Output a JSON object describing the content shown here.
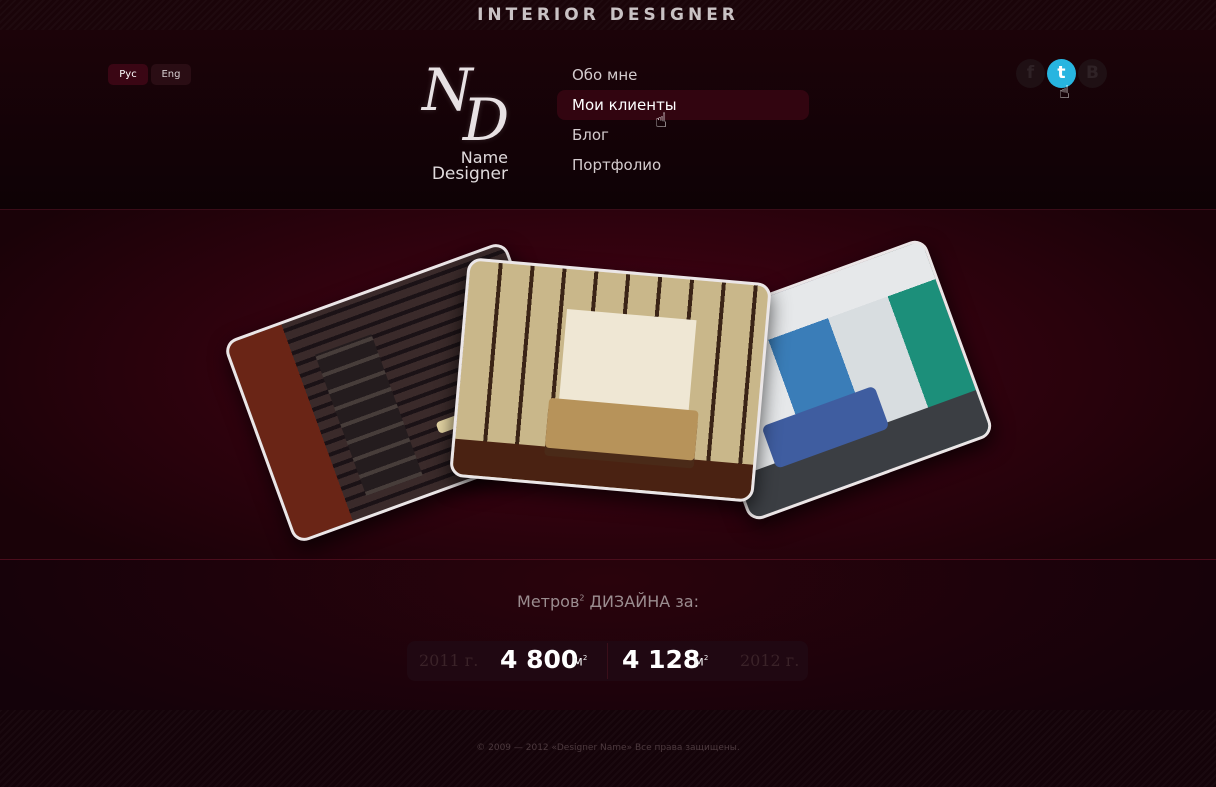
{
  "site_title": "INTERIOR DESIGNER",
  "languages": [
    {
      "label": "Рус",
      "active": true
    },
    {
      "label": "Eng",
      "active": false
    }
  ],
  "logo": {
    "monogram_n": "N",
    "monogram_d": "D",
    "line1": "Name",
    "line2": "Designer"
  },
  "nav": {
    "items": [
      {
        "label": "Обо мне",
        "active": false
      },
      {
        "label": "Мои клиенты",
        "active": true
      },
      {
        "label": "Блог",
        "active": false
      },
      {
        "label": "Портфолио",
        "active": false
      }
    ]
  },
  "social": [
    {
      "name": "facebook-icon",
      "glyph": "f"
    },
    {
      "name": "twitter-icon",
      "glyph": "t",
      "active": true
    },
    {
      "name": "vkontakte-icon",
      "glyph": "В"
    }
  ],
  "gallery": {
    "photos": [
      "interior-photo-loft",
      "interior-photo-japanese-bedroom",
      "interior-photo-blue-bedroom"
    ]
  },
  "stats": {
    "title_prefix": "Метров",
    "title_sup": "2",
    "title_suffix": " ДИЗАЙНА за:",
    "left": {
      "year": "2011 г.",
      "value": "4 800",
      "unit": "м",
      "unit_sup": "2"
    },
    "right": {
      "year": "2012 г.",
      "value": "4 128",
      "unit": "м",
      "unit_sup": "2"
    }
  },
  "footer": {
    "copyright": "© 2009 — 2012 «Designer Name» Все права защищены."
  },
  "colors": {
    "background": "#120308",
    "accent": "#5a0520",
    "twitter": "#27b5e0"
  }
}
